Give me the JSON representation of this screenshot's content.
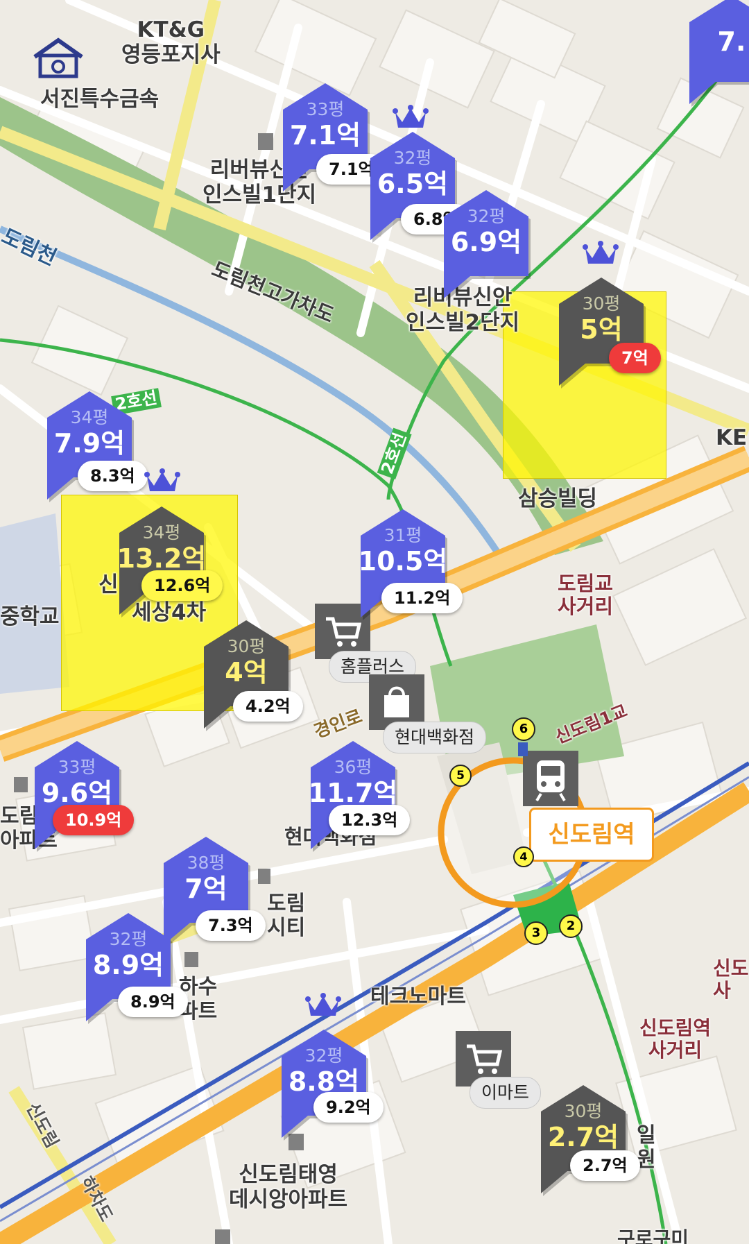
{
  "map": {
    "place_labels": [
      {
        "id": "ktng",
        "text": "KT&G\n영등포지사"
      },
      {
        "id": "seojin",
        "text": "서진특수금속"
      },
      {
        "id": "riverview1",
        "text": "리버뷰신안\n인스빌1단지"
      },
      {
        "id": "riverview2",
        "text": "리버뷰신안\n인스빌2단지"
      },
      {
        "id": "dorimcheon",
        "text": "도림천"
      },
      {
        "id": "dorimcheon-road",
        "text": "도림천고가차도"
      },
      {
        "id": "line2-west",
        "text": "2호선"
      },
      {
        "id": "line2-north",
        "text": "2호선"
      },
      {
        "id": "samseung",
        "text": "삼승빌딩"
      },
      {
        "id": "ke-partial",
        "text": "KE"
      },
      {
        "id": "dorimgyo",
        "text": "도림교\n사거리"
      },
      {
        "id": "middle-school",
        "text": "중학교"
      },
      {
        "id": "sesang",
        "text": "세상4차"
      },
      {
        "id": "sin-partial",
        "text": "신"
      },
      {
        "id": "gyeongin",
        "text": "경인로"
      },
      {
        "id": "sindorim1gyo",
        "text": "신도림1교"
      },
      {
        "id": "hyundai-apt",
        "text": "현대백화점"
      },
      {
        "id": "dorim-apt",
        "text": "도림\n아파트"
      },
      {
        "id": "dorim-city",
        "text": "도림\n시티"
      },
      {
        "id": "hasu",
        "text": "하수\n파트"
      },
      {
        "id": "techno",
        "text": "테크노마트"
      },
      {
        "id": "sindorim-crossroad",
        "text": "신도림역\n사거리"
      },
      {
        "id": "sindorim-right",
        "text": "신도\n사"
      },
      {
        "id": "taeyoung",
        "text": "신도림태영\n데시앙아파트"
      },
      {
        "id": "il-partial",
        "text": "일\n원"
      },
      {
        "id": "sindorim-rail",
        "text": "신도림"
      },
      {
        "id": "hachado",
        "text": "하차도"
      },
      {
        "id": "bottom-partial",
        "text": "구로구미"
      }
    ],
    "station": {
      "name": "신도림역",
      "exits": [
        "6",
        "5",
        "4",
        "3",
        "2"
      ]
    },
    "pois": [
      {
        "id": "homeplus",
        "label": "홈플러스",
        "icon": "cart-icon"
      },
      {
        "id": "hyundai-dept",
        "label": "현대백화점",
        "icon": "shopping-bag-icon"
      },
      {
        "id": "emart",
        "label": "이마트",
        "icon": "cart-icon"
      }
    ],
    "listings": [
      {
        "id": "l1",
        "pyeong": "33평",
        "price": "7.1억",
        "bubble": "7.1억",
        "style": "blue",
        "bubble_style": "white",
        "crown": false
      },
      {
        "id": "l2",
        "pyeong": "32평",
        "price": "6.5억",
        "bubble": "6.8억",
        "style": "blue",
        "bubble_style": "white",
        "crown": true
      },
      {
        "id": "l3",
        "pyeong": "32평",
        "price": "6.9억",
        "bubble": "",
        "style": "blue",
        "bubble_style": "white",
        "crown": false
      },
      {
        "id": "l4",
        "pyeong": "30평",
        "price": "5억",
        "bubble": "7억",
        "style": "dark",
        "bubble_style": "red",
        "crown": true
      },
      {
        "id": "l5",
        "pyeong": "34평",
        "price": "7.9억",
        "bubble": "8.3억",
        "style": "blue",
        "bubble_style": "white",
        "crown": false
      },
      {
        "id": "l6",
        "pyeong": "34평",
        "price": "13.2억",
        "bubble": "12.6억",
        "style": "dark",
        "bubble_style": "yellow",
        "crown": true
      },
      {
        "id": "l7",
        "pyeong": "31평",
        "price": "10.5억",
        "bubble": "11.2억",
        "style": "blue",
        "bubble_style": "white",
        "crown": false
      },
      {
        "id": "l8",
        "pyeong": "30평",
        "price": "4억",
        "bubble": "4.2억",
        "style": "dark",
        "bubble_style": "white",
        "crown": false
      },
      {
        "id": "l9",
        "pyeong": "33평",
        "price": "9.6억",
        "bubble": "10.9억",
        "style": "blue",
        "bubble_style": "red",
        "crown": false
      },
      {
        "id": "l10",
        "pyeong": "36평",
        "price": "11.7억",
        "bubble": "12.3억",
        "style": "blue",
        "bubble_style": "white",
        "crown": false
      },
      {
        "id": "l11",
        "pyeong": "38평",
        "price": "7억",
        "bubble": "7.3억",
        "style": "blue",
        "bubble_style": "white",
        "crown": false
      },
      {
        "id": "l12",
        "pyeong": "32평",
        "price": "8.9억",
        "bubble": "8.9억",
        "style": "blue",
        "bubble_style": "white",
        "crown": false
      },
      {
        "id": "l13",
        "pyeong": "32평",
        "price": "8.8억",
        "bubble": "9.2억",
        "style": "blue",
        "bubble_style": "white",
        "crown": true
      },
      {
        "id": "l14",
        "pyeong": "30평",
        "price": "2.7억",
        "bubble": "2.7억",
        "style": "dark",
        "bubble_style": "white",
        "crown": false
      },
      {
        "id": "l15",
        "pyeong": "",
        "price": "7.",
        "bubble": "",
        "style": "blue",
        "bubble_style": "red",
        "crown": false
      }
    ],
    "colors": {
      "listing_blue": "#5a5fe0",
      "listing_dark": "#555555",
      "highlight_yellow": "#fff600",
      "bubble_red": "#ef3b3b",
      "station_orange": "#f39a1e",
      "subway_green": "#3cb44b",
      "river_green": "#9cc48a",
      "major_road": "#f8b33c"
    }
  }
}
